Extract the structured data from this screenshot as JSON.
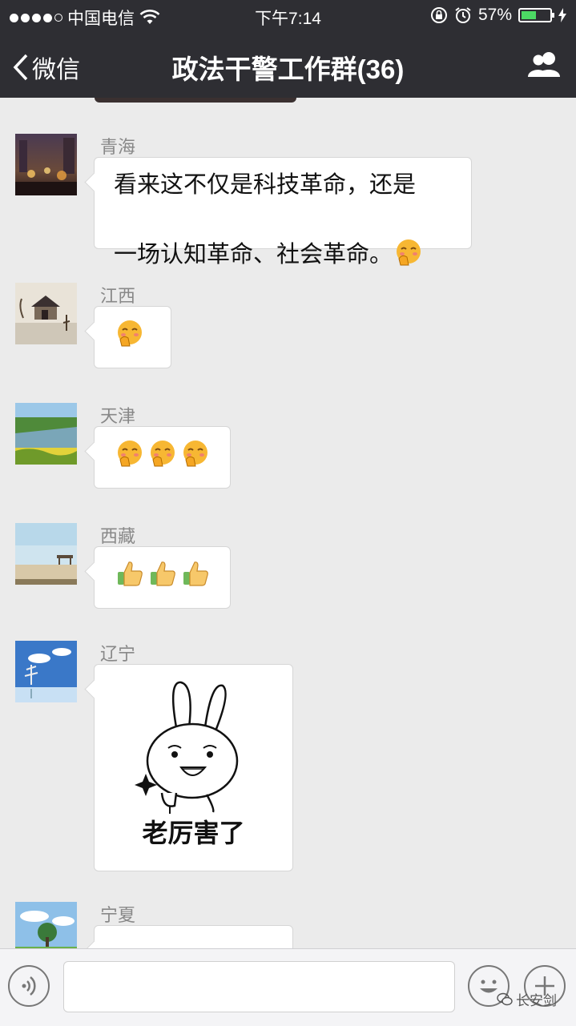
{
  "status_bar": {
    "carrier": "中国电信",
    "time": "下午7:14",
    "battery": "57%",
    "battery_level": 0.57
  },
  "nav": {
    "back_label": "微信",
    "title": "政法干警工作群(36)"
  },
  "messages": [
    {
      "sender": "青海",
      "text": "看来这不仅是科技革命，还是\n一场认知革命、社会革命。",
      "emojis": [
        "bashful-hand-over-mouth"
      ]
    },
    {
      "sender": "江西",
      "emojis": [
        "bashful-hand-over-mouth"
      ]
    },
    {
      "sender": "天津",
      "emojis": [
        "bashful-hand-over-mouth",
        "bashful-hand-over-mouth",
        "bashful-hand-over-mouth"
      ]
    },
    {
      "sender": "西藏",
      "emojis": [
        "thumbs-up",
        "thumbs-up",
        "thumbs-up"
      ]
    },
    {
      "sender": "辽宁",
      "sticker_caption": "老厉害了"
    },
    {
      "sender": "宁夏"
    }
  ],
  "watermark": "长安剑",
  "colors": {
    "header_bg": "#2e2e33",
    "chat_bg": "#ebebeb",
    "battery_fill": "#4cd964"
  }
}
